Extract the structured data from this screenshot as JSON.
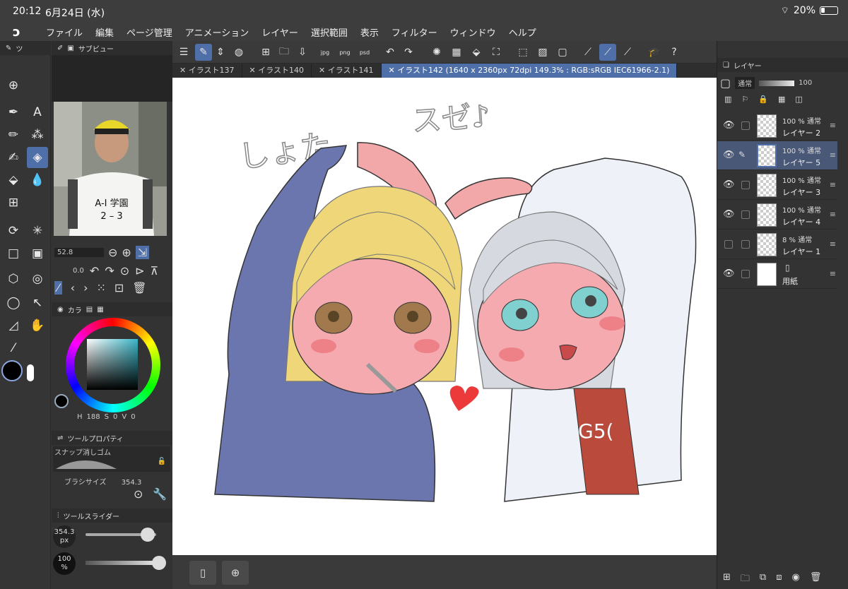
{
  "status": {
    "time": "20:12",
    "date": "6月24日 (水)",
    "battery": "20%"
  },
  "menu": [
    "ファイル",
    "編集",
    "ページ管理",
    "アニメーション",
    "レイヤー",
    "選択範囲",
    "表示",
    "フィルター",
    "ウィンドウ",
    "ヘルプ"
  ],
  "left": {
    "tool_tab": "ツ",
    "subview_title": "サブビュー",
    "photo_shirt_line1": "A-I 学園",
    "photo_shirt_line2": "2 – 3",
    "brush_size_field": "52.8",
    "rotation_value": "0.0",
    "color_tab": "カラ",
    "color_values": {
      "h": "188",
      "s_label": "S",
      "s": "0",
      "v_label": "V",
      "v": "0"
    },
    "tool_property_title": "ツールプロパティ",
    "tool_property_preset": "スナップ消しゴム",
    "brush_size_label": "ブラシサイズ",
    "brush_size_value": "354.3",
    "tool_slider_title": "ツールスライダー",
    "slider_size": "354.3",
    "slider_size_unit": "px",
    "slider_opacity": "100",
    "slider_opacity_unit": "%"
  },
  "tabs": [
    {
      "label": "イラスト137"
    },
    {
      "label": "イラスト140"
    },
    {
      "label": "イラスト141"
    },
    {
      "label": "イラスト142 (1640 x 2360px 72dpi 149.3% : RGB:sRGB IEC61966-2.1)",
      "active": true
    }
  ],
  "canvas": {
    "text_left": "しょた",
    "text_right": "スゼ♪",
    "shirt_text": "G5("
  },
  "layers_panel": {
    "title": "レイヤー",
    "blend_mode": "通常",
    "opacity": "100",
    "layers": [
      {
        "pct": "100 %",
        "mode": "通常",
        "name": "レイヤー 2",
        "visible": true,
        "selected": false
      },
      {
        "pct": "100 %",
        "mode": "通常",
        "name": "レイヤー 5",
        "visible": true,
        "selected": true
      },
      {
        "pct": "100 %",
        "mode": "通常",
        "name": "レイヤー 3",
        "visible": true,
        "selected": false
      },
      {
        "pct": "100 %",
        "mode": "通常",
        "name": "レイヤー 4",
        "visible": true,
        "selected": false
      },
      {
        "pct": "8 %",
        "mode": "通常",
        "name": "レイヤー 1",
        "visible": false,
        "selected": false
      },
      {
        "pct": "",
        "mode": "",
        "name": "用紙",
        "visible": true,
        "selected": false
      }
    ]
  },
  "colors": {
    "accent": "#4f6fa8",
    "panel": "#333333"
  }
}
